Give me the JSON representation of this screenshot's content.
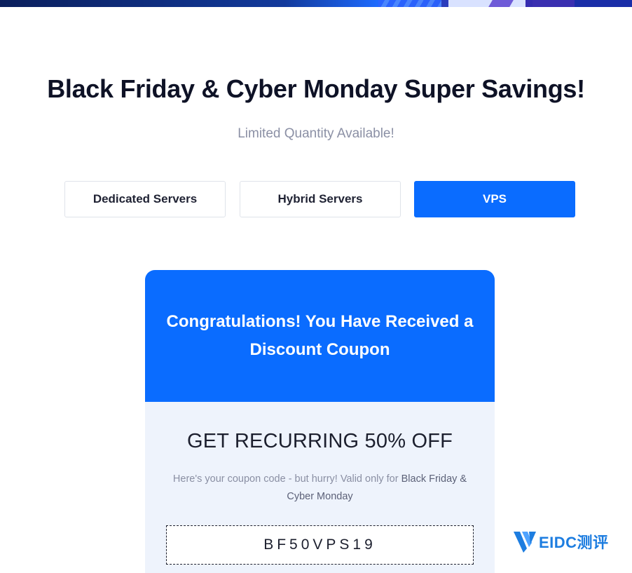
{
  "page": {
    "headline": "Black Friday & Cyber Monday Super Savings!",
    "subline": "Limited Quantity Available!"
  },
  "tabs": [
    {
      "label": "Dedicated Servers",
      "active": false
    },
    {
      "label": "Hybrid Servers",
      "active": false
    },
    {
      "label": "VPS",
      "active": true
    }
  ],
  "card": {
    "header_text": "Congratulations! You Have Received a Discount Coupon",
    "offer_title": "GET RECURRING 50% OFF",
    "description_prefix": "Here's your coupon code - but hurry! Valid only for",
    "description_emphasis": "Black Friday & Cyber Monday",
    "coupon_code": "BF50VPS19"
  },
  "watermark": {
    "text": "EIDC测评"
  },
  "colors": {
    "accent": "#0a6cff",
    "heading": "#0e1226",
    "muted": "#8b90a5",
    "card_body_bg": "#eef3fc"
  }
}
